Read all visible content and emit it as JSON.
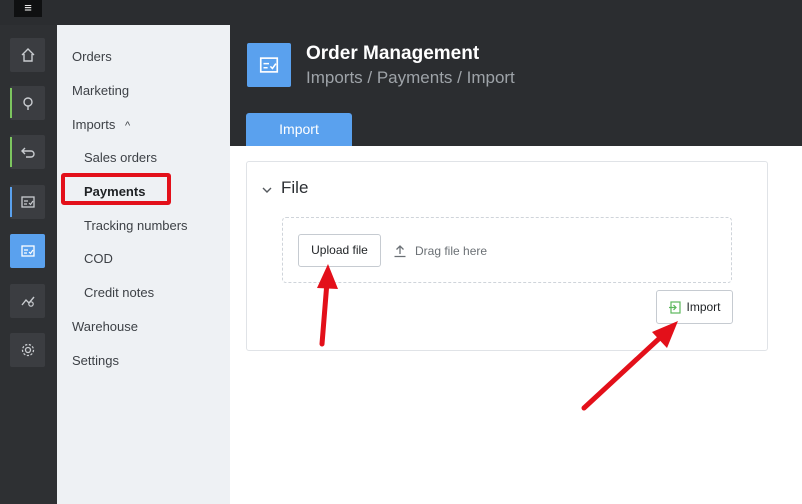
{
  "topbar": {
    "menu_icon": "hamburger-icon"
  },
  "rail": {
    "icons": [
      "home-icon",
      "location-pin-icon",
      "return-arrow-icon",
      "order-doc-icon",
      "order-management-icon",
      "analytics-icon",
      "settings-gear-icon"
    ],
    "active_color": "#5aa1ee"
  },
  "sidenav": {
    "items": [
      {
        "label": "Orders"
      },
      {
        "label": "Marketing"
      },
      {
        "label": "Imports",
        "expanded_icon": "^"
      },
      {
        "label": "Sales orders"
      },
      {
        "label": "Payments"
      },
      {
        "label": "Tracking numbers"
      },
      {
        "label": "COD"
      },
      {
        "label": "Credit notes"
      },
      {
        "label": "Warehouse"
      },
      {
        "label": "Settings"
      }
    ]
  },
  "header": {
    "title": "Order Management",
    "breadcrumb": "Imports / Payments / Import",
    "tab_label": "Import"
  },
  "file_section": {
    "collapse_icon": "chevron-down-icon",
    "title": "File",
    "upload_label": "Upload file",
    "drag_label": "Drag file here",
    "import_label": "Import"
  },
  "colors": {
    "accent": "#5aa1ee",
    "annotation": "#e3101a",
    "import_icon": "#5cb85c"
  }
}
